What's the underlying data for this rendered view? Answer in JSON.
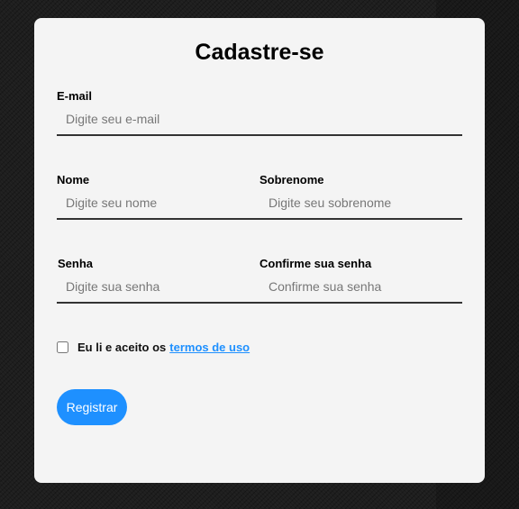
{
  "form": {
    "title": "Cadastre-se",
    "email": {
      "label": "E-mail",
      "placeholder": "Digite seu e-mail",
      "value": ""
    },
    "first_name": {
      "label": "Nome",
      "placeholder": "Digite seu nome",
      "value": ""
    },
    "last_name": {
      "label": "Sobrenome",
      "placeholder": "Digite seu sobrenome",
      "value": ""
    },
    "password": {
      "label": "Senha",
      "placeholder": "Digite sua senha",
      "value": ""
    },
    "confirm_password": {
      "label": "Confirme sua senha",
      "placeholder": "Confirme sua senha",
      "value": ""
    },
    "terms": {
      "text": "Eu li e aceito os",
      "link_text": "termos de uso",
      "checked": false
    },
    "submit_label": "Registrar"
  },
  "colors": {
    "accent": "#1e90ff",
    "card_background": "#f4f4f4",
    "page_background": "#1e1e1e"
  }
}
